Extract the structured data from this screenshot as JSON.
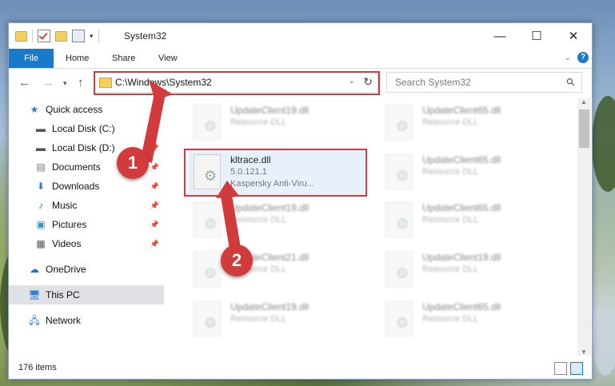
{
  "window": {
    "title": "System32"
  },
  "caption_buttons": {
    "minimize": "—",
    "maximize": "☐",
    "close": "✕"
  },
  "ribbon": {
    "tabs": [
      "File",
      "Home",
      "Share",
      "View"
    ],
    "help": "?"
  },
  "address": {
    "path": "C:\\Windows\\System32"
  },
  "search": {
    "placeholder": "Search System32"
  },
  "nav": {
    "items": [
      {
        "label": "Quick access",
        "icon": "star-icon"
      },
      {
        "label": "Local Disk (C:)",
        "icon": "drive-icon",
        "pinned": true
      },
      {
        "label": "Local Disk (D:)",
        "icon": "drive-icon",
        "pinned": true
      },
      {
        "label": "Documents",
        "icon": "documents-icon",
        "pinned": true
      },
      {
        "label": "Downloads",
        "icon": "downloads-icon",
        "pinned": true
      },
      {
        "label": "Music",
        "icon": "music-icon",
        "pinned": true
      },
      {
        "label": "Pictures",
        "icon": "pictures-icon",
        "pinned": true
      },
      {
        "label": "Videos",
        "icon": "videos-icon",
        "pinned": true
      },
      {
        "label": "OneDrive",
        "icon": "onedrive-icon"
      },
      {
        "label": "This PC",
        "icon": "pc-icon",
        "selected": true
      },
      {
        "label": "Network",
        "icon": "network-icon"
      }
    ]
  },
  "files": {
    "left": [
      {
        "name": "UpdateClient19.dll",
        "type": "Resource DLL"
      },
      {
        "name": "kltrace.dll",
        "version": "5.0.121.1",
        "company": "Kaspersky Anti-Viru..."
      },
      {
        "name": "UpdateClient19.dll",
        "type": "Resource DLL"
      },
      {
        "name": "UpdateClient21.dll",
        "type": "Resource DLL"
      },
      {
        "name": "UpdateClient19.dll",
        "type": "Resource DLL"
      }
    ],
    "right": [
      {
        "name": "UpdateClient65.dll",
        "type": "Resource DLL"
      },
      {
        "name": "UpdateClient65.dll",
        "type": "Resource DLL"
      },
      {
        "name": "UpdateClient65.dll",
        "type": "Resource DLL"
      },
      {
        "name": "UpdateClient19.dll",
        "type": "Resource DLL"
      },
      {
        "name": "UpdateClient65.dll",
        "type": "Resource DLL"
      }
    ]
  },
  "status": {
    "count": "176 items"
  },
  "callouts": {
    "first": "1",
    "second": "2"
  },
  "colors": {
    "accent": "#1979ca",
    "callout": "#d23b3b"
  }
}
